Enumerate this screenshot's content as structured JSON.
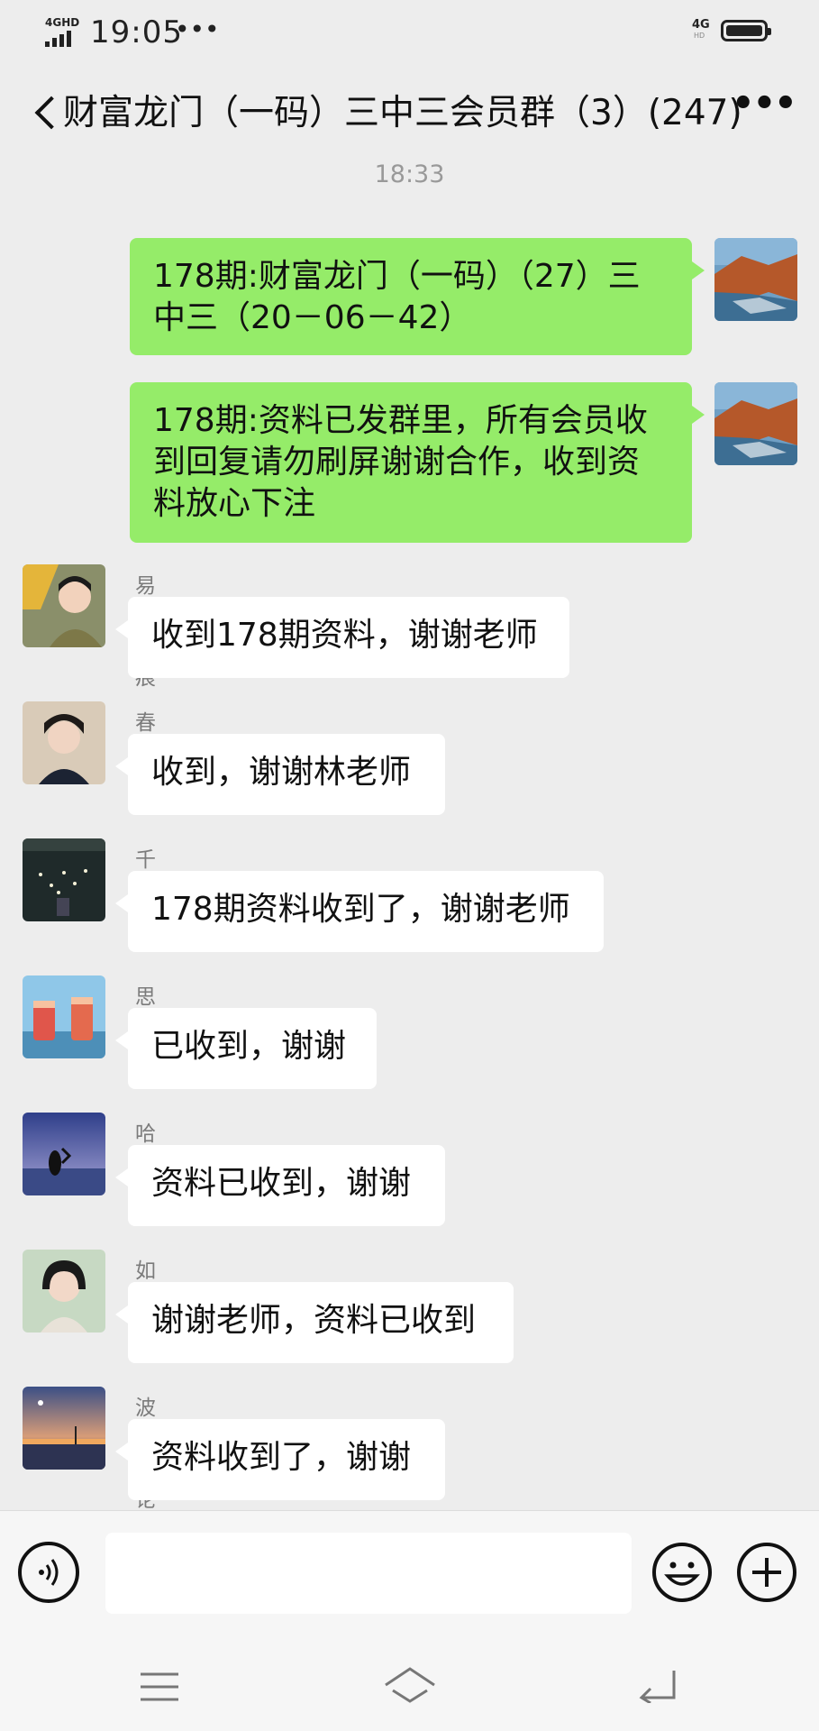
{
  "status_bar": {
    "network": "4GHD",
    "time": "19:05",
    "overflow": "•••",
    "network_right": "4G",
    "network_right_sub": "HD"
  },
  "header": {
    "title": "财富龙门（一码）三中三会员群（3）(247)",
    "more": "•••"
  },
  "timestamp": "18:33",
  "messages": [
    {
      "sender": "",
      "direction": "out",
      "text": "178期:财富龙门（一码）（27）三中三（20－06－42）",
      "avatar": "rocky-shore-avatar"
    },
    {
      "sender": "",
      "direction": "out",
      "text": "178期:资料已发群里，所有会员收到回复请勿刷屏谢谢合作，收到资料放心下注",
      "avatar": "rocky-shore-avatar"
    },
    {
      "sender": "易水无痕",
      "direction": "in",
      "text": "收到178期资料，谢谢老师",
      "avatar": "girl-yellow-avatar"
    },
    {
      "sender": "春慵",
      "direction": "in",
      "text": "收到，谢谢林老师",
      "avatar": "girl-dark-avatar"
    },
    {
      "sender": "千城",
      "direction": "in",
      "text": "178期资料收到了，谢谢老师",
      "avatar": "night-lights-avatar"
    },
    {
      "sender": "思琴MM",
      "direction": "in",
      "text": "已收到，谢谢",
      "avatar": "drinks-avatar"
    },
    {
      "sender": "哈哈哈",
      "direction": "in",
      "text": "资料已收到，谢谢",
      "avatar": "sunset-heart-avatar"
    },
    {
      "sender": "如果",
      "direction": "in",
      "text": "谢谢老师，资料已收到",
      "avatar": "girl-short-hair-avatar"
    },
    {
      "sender": "波浪理论",
      "direction": "in",
      "text": "资料收到了，谢谢",
      "avatar": "sea-sunset-avatar"
    }
  ],
  "input_bar": {
    "value": "",
    "icons": [
      "voice-icon",
      "emoji-icon",
      "plus-icon"
    ]
  },
  "nav": {
    "icons": [
      "menu-icon",
      "home-icon",
      "back-icon"
    ]
  },
  "colors": {
    "outgoing_bubble": "#95ec69",
    "incoming_bubble": "#ffffff",
    "background": "#ededed"
  }
}
